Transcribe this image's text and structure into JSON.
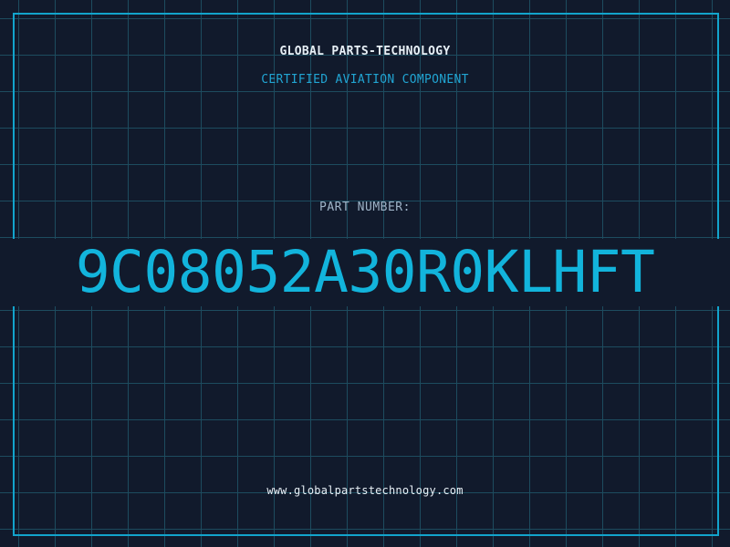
{
  "header": {
    "company": "GLOBAL PARTS-TECHNOLOGY",
    "tagline": "CERTIFIED AVIATION COMPONENT"
  },
  "part": {
    "label": "PART NUMBER:",
    "number": "9C08052A30R0KLHFT"
  },
  "footer": {
    "website": "www.globalpartstechnology.com"
  },
  "colors": {
    "background": "#111a2c",
    "grid": "#1d4c5f",
    "accent": "#12b4dc",
    "text": "#e8f0f6",
    "label": "#9fb4c8"
  }
}
